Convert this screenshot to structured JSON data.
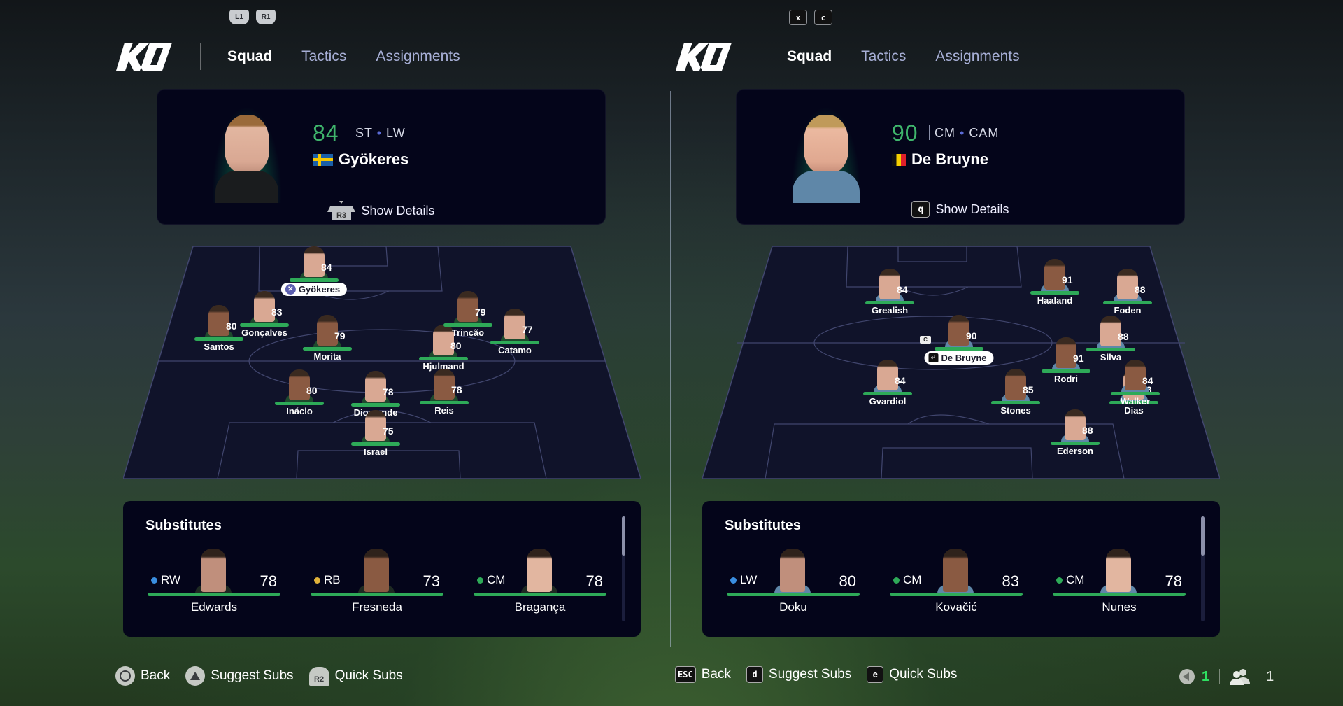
{
  "left": {
    "shoulder_buttons": [
      "L1",
      "R1"
    ],
    "tabs": [
      {
        "label": "Squad",
        "active": true
      },
      {
        "label": "Tactics",
        "active": false
      },
      {
        "label": "Assignments",
        "active": false
      }
    ],
    "selected": {
      "rating": "84",
      "positions": [
        "ST",
        "LW"
      ],
      "name": "Gyökeres",
      "flag": "sweden",
      "details_button": "R3",
      "details_label": "Show Details"
    },
    "lineup": [
      {
        "name": "Gyökeres",
        "rating": "84",
        "selected": true,
        "pill_icon": "cross-button"
      },
      {
        "name": "Santos",
        "rating": "80"
      },
      {
        "name": "Gonçalves",
        "rating": "83"
      },
      {
        "name": "Morita",
        "rating": "79"
      },
      {
        "name": "Hjulmand",
        "rating": "80"
      },
      {
        "name": "Trincão",
        "rating": "79"
      },
      {
        "name": "Catamo",
        "rating": "77"
      },
      {
        "name": "Inácio",
        "rating": "80"
      },
      {
        "name": "Diomande",
        "rating": "78"
      },
      {
        "name": "Reis",
        "rating": "78"
      },
      {
        "name": "Israel",
        "rating": "75"
      }
    ],
    "substitutes_title": "Substitutes",
    "substitutes": [
      {
        "position": "RW",
        "pos_color": "#3a8ee0",
        "rating": "78",
        "name": "Edwards"
      },
      {
        "position": "RB",
        "pos_color": "#e0b23a",
        "rating": "73",
        "name": "Fresneda"
      },
      {
        "position": "CM",
        "pos_color": "#2eaa58",
        "rating": "78",
        "name": "Bragança"
      }
    ],
    "footer": [
      {
        "icon": "circle-button",
        "label": "Back"
      },
      {
        "icon": "triangle-button",
        "label": "Suggest Subs"
      },
      {
        "icon": "r2-button",
        "key": "R2",
        "label": "Quick Subs"
      }
    ]
  },
  "right": {
    "shoulder_keys": [
      "x",
      "c"
    ],
    "tabs": [
      {
        "label": "Squad",
        "active": true
      },
      {
        "label": "Tactics",
        "active": false
      },
      {
        "label": "Assignments",
        "active": false
      }
    ],
    "selected": {
      "rating": "90",
      "positions": [
        "CM",
        "CAM"
      ],
      "name": "De Bruyne",
      "flag": "belgium",
      "details_key": "q",
      "details_label": "Show Details"
    },
    "lineup": [
      {
        "name": "Grealish",
        "rating": "84"
      },
      {
        "name": "Haaland",
        "rating": "91"
      },
      {
        "name": "Foden",
        "rating": "88"
      },
      {
        "name": "De Bruyne",
        "rating": "90",
        "selected": true,
        "captain": "C"
      },
      {
        "name": "Silva",
        "rating": "88"
      },
      {
        "name": "Rodri",
        "rating": "91"
      },
      {
        "name": "Gvardiol",
        "rating": "84"
      },
      {
        "name": "Stones",
        "rating": "85"
      },
      {
        "name": "Dias",
        "rating": "88"
      },
      {
        "name": "Walker",
        "rating": "84"
      },
      {
        "name": "Ederson",
        "rating": "88"
      }
    ],
    "substitutes_title": "Substitutes",
    "substitutes": [
      {
        "position": "LW",
        "pos_color": "#3a8ee0",
        "rating": "80",
        "name": "Doku"
      },
      {
        "position": "CM",
        "pos_color": "#2eaa58",
        "rating": "83",
        "name": "Kovačić"
      },
      {
        "position": "CM",
        "pos_color": "#2eaa58",
        "rating": "78",
        "name": "Nunes"
      }
    ],
    "footer": [
      {
        "key": "ESC",
        "label": "Back"
      },
      {
        "key": "d",
        "label": "Suggest Subs"
      },
      {
        "key": "e",
        "label": "Quick Subs"
      }
    ]
  },
  "status": {
    "voice_count": "1",
    "players_count": "1"
  },
  "colors": {
    "accent_green": "#2eaa58",
    "rating_green": "#3fb56c",
    "tab_inactive": "#a7afd6",
    "panel_bg": "#04051a"
  }
}
